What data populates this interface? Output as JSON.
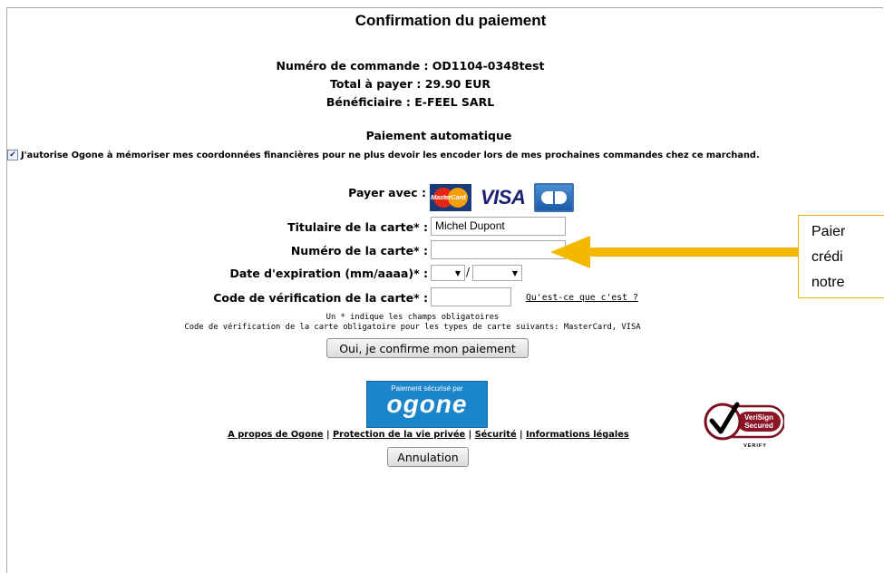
{
  "title": "Confirmation du paiement",
  "order": {
    "number_line": "Numéro de commande : OD1104-0348test",
    "total_line": "Total à payer : 29.90 EUR",
    "beneficiary_line": "Bénéficiaire : E-FEEL SARL"
  },
  "auto_payment": {
    "title": "Paiement automatique",
    "consent_text": "J'autorise Ogone à mémoriser mes coordonnées financières pour ne plus devoir les encoder lors de mes prochaines commandes chez ce marchand.",
    "checked": true
  },
  "payment": {
    "pay_with_label": "Payer avec :",
    "card_logos": [
      "MasterCard",
      "VISA",
      "CB"
    ],
    "holder_label": "Titulaire de la carte* :",
    "holder_value": "Michel Dupont",
    "number_label": "Numéro de la carte* :",
    "number_value": "",
    "expiry_label": "Date d'expiration (mm/aaaa)* :",
    "expiry_separator": "/",
    "cvc_label": "Code de vérification de la carte* :",
    "cvc_value": "",
    "cvc_help_link": "Qu'est-ce que c'est ?",
    "note_required": "Un * indique les champs obligatoires",
    "note_cvc": "Code de vérification de la carte obligatoire pour les types de carte suivants: MasterCard, VISA",
    "confirm_button": "Oui, je confirme mon paiement"
  },
  "ogone_badge": {
    "small": "Paiement sécurisé par",
    "brand": "ogone"
  },
  "footer": {
    "about": "A propos de Ogone",
    "privacy": "Protection de la vie privée",
    "security": "Sécurité",
    "legal": "Informations légales",
    "separator": "|",
    "cancel_button": "Annulation"
  },
  "verisign": {
    "line1": "VeriSign",
    "line2": "Secured",
    "line3": "VERIFY"
  },
  "callout": {
    "line1": "Paier",
    "line2": "crédi",
    "line3": "notre",
    "color": "#f0b400"
  }
}
